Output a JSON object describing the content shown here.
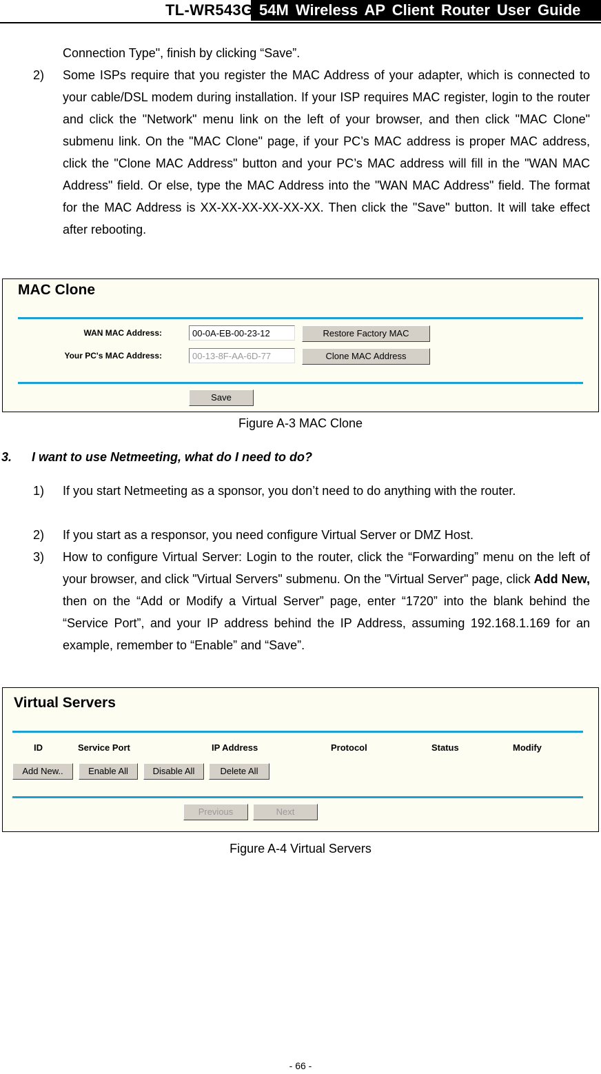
{
  "header": {
    "model": "TL-WR543G",
    "title": "54M  Wireless  AP  Client  Router  User  Guide"
  },
  "intro_continuation": "Connection Type\", finish by clicking “Save”.",
  "item2": {
    "number": "2)",
    "text": "Some ISPs require that you register the MAC Address of your adapter, which is connected to your cable/DSL modem during installation. If your ISP requires MAC register, login to the router and click the \"Network\" menu link on the left of your browser, and then click \"MAC Clone\" submenu link. On the \"MAC Clone\" page, if your PC’s MAC address is proper MAC address, click the \"Clone MAC Address\" button and your PC’s MAC address will fill in the \"WAN MAC Address\" field. Or else, type the MAC Address into the \"WAN MAC Address\" field. The format for the MAC Address is XX-XX-XX-XX-XX-XX. Then click the \"Save\" button. It will take effect after rebooting."
  },
  "mac_clone": {
    "title": "MAC Clone",
    "wan_label": "WAN MAC Address:",
    "wan_value": "00-0A-EB-00-23-12",
    "pc_label": "Your PC's MAC Address:",
    "pc_value": "00-13-8F-AA-6D-77",
    "restore_button": "Restore Factory MAC",
    "clone_button": "Clone MAC Address",
    "save_button": "Save",
    "caption": "Figure A-3    MAC Clone"
  },
  "question3": {
    "number": "3.",
    "text": "I want to use Netmeeting, what do I need to do?",
    "items": [
      {
        "number": "1)",
        "text": "If you start Netmeeting as a sponsor, you don’t need to do anything with the router."
      },
      {
        "number": "2)",
        "text": "If you start as a responsor, you need configure Virtual Server or DMZ Host."
      },
      {
        "number": "3)",
        "text_before": "How to configure Virtual Server: Login to the router, click the “Forwarding” menu on the left of your browser, and click \"Virtual Servers\" submenu. On the \"Virtual Server\" page, click ",
        "bold": "Add New,",
        "text_after": " then on the “Add or Modify a Virtual Server” page, enter “1720” into the blank behind the “Service Port”, and your IP address behind the IP Address, assuming 192.168.1.169 for an example, remember to “Enable” and “Save”."
      }
    ]
  },
  "virtual_servers": {
    "title": "Virtual Servers",
    "columns": [
      "ID",
      "Service Port",
      "IP Address",
      "Protocol",
      "Status",
      "Modify"
    ],
    "buttons": [
      "Add New..",
      "Enable All",
      "Disable All",
      "Delete All"
    ],
    "previous_button": "Previous",
    "next_button": "Next",
    "caption": "Figure A-4    Virtual Servers"
  },
  "colors": {
    "accent_rule": "#1ca0d4",
    "panel_bg": "#fdfdf2",
    "button_bg": "#d4d0c8"
  },
  "footer": {
    "page_number": "- 66 -"
  }
}
